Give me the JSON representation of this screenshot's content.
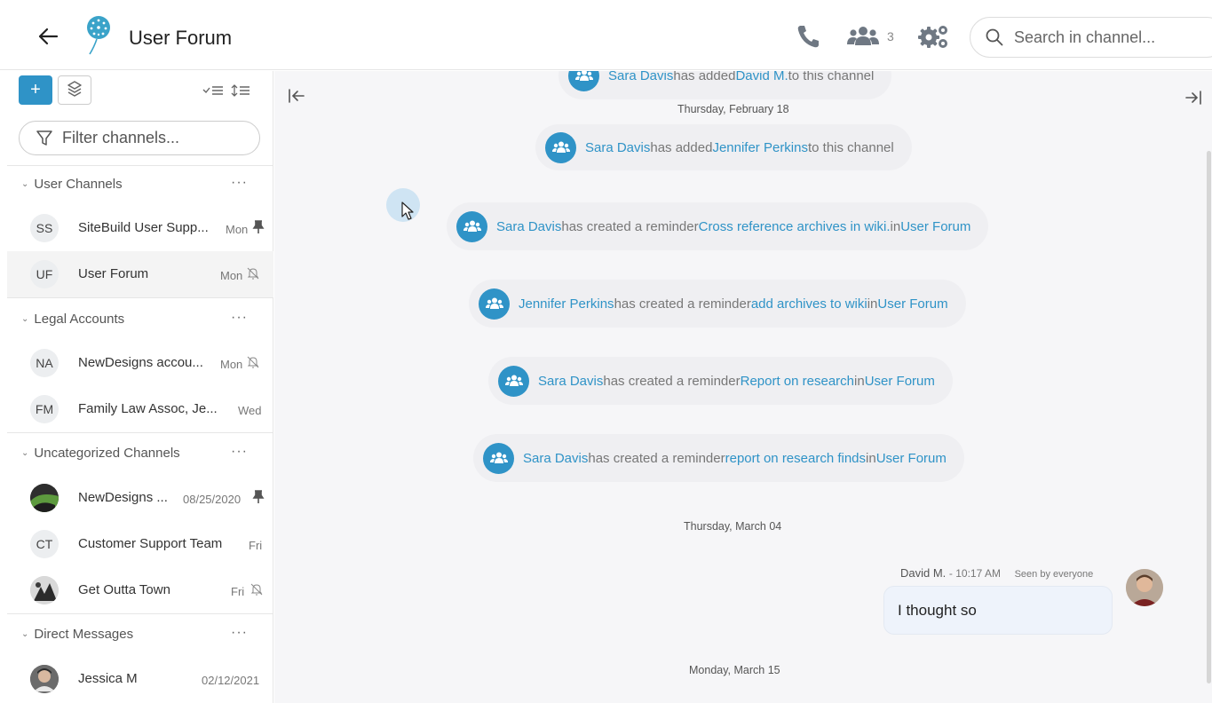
{
  "header": {
    "title": "User Forum",
    "member_count": "3",
    "search_placeholder": "Search in channel..."
  },
  "sidebar": {
    "filter_placeholder": "Filter channels...",
    "sections": [
      {
        "title": "User Channels",
        "channels": [
          {
            "initials": "SS",
            "name": "SiteBuild User Supp...",
            "date": "Mon",
            "status": "pinned"
          },
          {
            "initials": "UF",
            "name": "User Forum",
            "date": "Mon",
            "status": "muted"
          }
        ]
      },
      {
        "title": "Legal Accounts",
        "channels": [
          {
            "initials": "NA",
            "name": "NewDesigns accou...",
            "date": "Mon",
            "status": "muted"
          },
          {
            "initials": "FM",
            "name": "Family Law Assoc, Je...",
            "date": "Wed",
            "status": ""
          }
        ]
      },
      {
        "title": "Uncategorized Channels",
        "channels": [
          {
            "initials": "",
            "name": "NewDesigns ...",
            "date": "08/25/2020",
            "status": "pinned"
          },
          {
            "initials": "CT",
            "name": "Customer Support Team",
            "date": "Fri",
            "status": ""
          },
          {
            "initials": "",
            "name": "Get Outta Town",
            "date": "Fri",
            "status": "muted"
          }
        ]
      },
      {
        "title": "Direct Messages",
        "channels": [
          {
            "initials": "",
            "name": "Jessica M",
            "date": "02/12/2021",
            "status": ""
          }
        ]
      }
    ]
  },
  "chat": {
    "events": [
      {
        "actor": "Sara Davis",
        "text": " has added ",
        "object": "David M.",
        "suffix": " to this channel"
      },
      {
        "actor": "Sara Davis",
        "text": " has added ",
        "object": "Jennifer Perkins",
        "suffix": " to this channel"
      },
      {
        "actor": "Sara Davis",
        "text": " has created a reminder ",
        "object": "Cross reference archives in wiki.",
        "mid": " in ",
        "channel": "User Forum"
      },
      {
        "actor": "Jennifer Perkins",
        "text": " has created a reminder ",
        "object": "add archives to wiki",
        "mid": " in ",
        "channel": "User Forum"
      },
      {
        "actor": "Sara Davis",
        "text": " has created a reminder ",
        "object": "Report on research",
        "mid": " in ",
        "channel": "User Forum"
      },
      {
        "actor": "Sara Davis",
        "text": " has created a reminder ",
        "object": "report on research finds",
        "mid": " in ",
        "channel": "User Forum"
      }
    ],
    "dates": [
      "Thursday, February 18",
      "Thursday, March 04",
      "Monday, March 15"
    ],
    "message": {
      "author": "David M.",
      "time": "- 10:17 AM",
      "seen": "Seen by everyone",
      "text": "I thought so"
    }
  },
  "colors": {
    "accent": "#2f93c7",
    "chat_bg": "#f6f6f8",
    "pill_bg": "#efeff2"
  }
}
